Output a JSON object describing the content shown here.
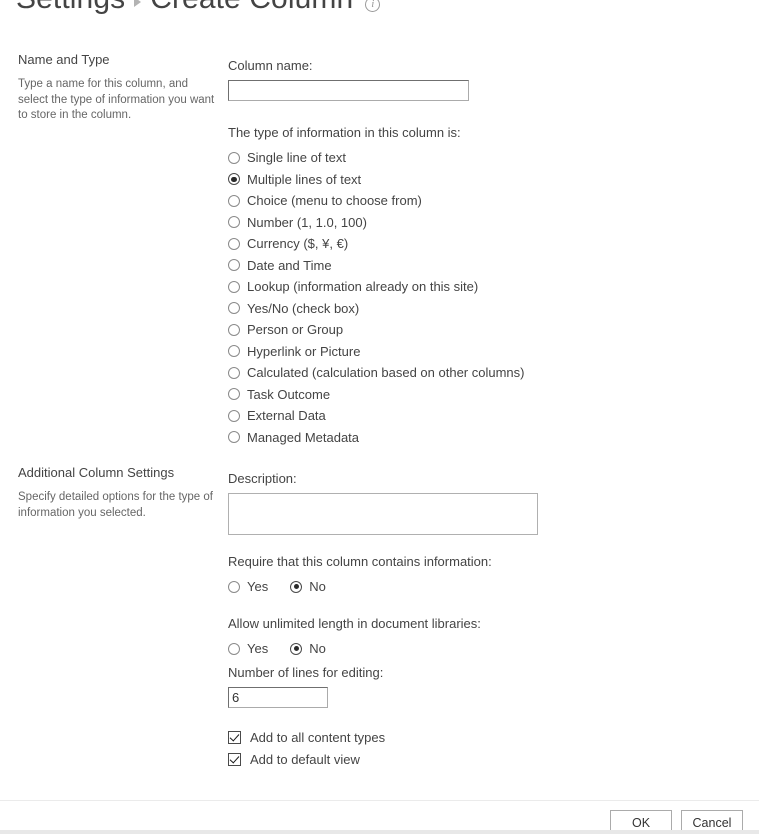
{
  "header": {
    "breadcrumb_root": "Settings",
    "breadcrumb_separator": "triangle-right",
    "title": "Create Column",
    "info_icon": "info-circle-icon",
    "info_glyph": "i"
  },
  "sections": {
    "name_and_type": {
      "title": "Name and Type",
      "description": "Type a name for this column, and select the type of information you want to store in the column."
    },
    "additional_settings": {
      "title": "Additional Column Settings",
      "description": "Specify detailed options for the type of information you selected."
    }
  },
  "column_name": {
    "label": "Column name:",
    "value": "",
    "placeholder": ""
  },
  "column_type": {
    "label": "The type of information in this column is:",
    "selected": "Multiple lines of text",
    "options": [
      "Single line of text",
      "Multiple lines of text",
      "Choice (menu to choose from)",
      "Number (1, 1.0, 100)",
      "Currency ($, ¥, €)",
      "Date and Time",
      "Lookup (information already on this site)",
      "Yes/No (check box)",
      "Person or Group",
      "Hyperlink or Picture",
      "Calculated (calculation based on other columns)",
      "Task Outcome",
      "External Data",
      "Managed Metadata"
    ]
  },
  "description_field": {
    "label": "Description:",
    "value": "",
    "placeholder": ""
  },
  "require_info": {
    "label": "Require that this column contains information:",
    "options": [
      "Yes",
      "No"
    ],
    "selected": "No"
  },
  "unlimited_length": {
    "label": "Allow unlimited length in document libraries:",
    "options": [
      "Yes",
      "No"
    ],
    "selected": "No"
  },
  "number_of_lines": {
    "label": "Number of lines for editing:",
    "value": "6"
  },
  "checkboxes": [
    {
      "label": "Add to all content types",
      "checked": true
    },
    {
      "label": "Add to default view",
      "checked": true
    }
  ],
  "footer": {
    "ok_label": "OK",
    "cancel_label": "Cancel"
  }
}
